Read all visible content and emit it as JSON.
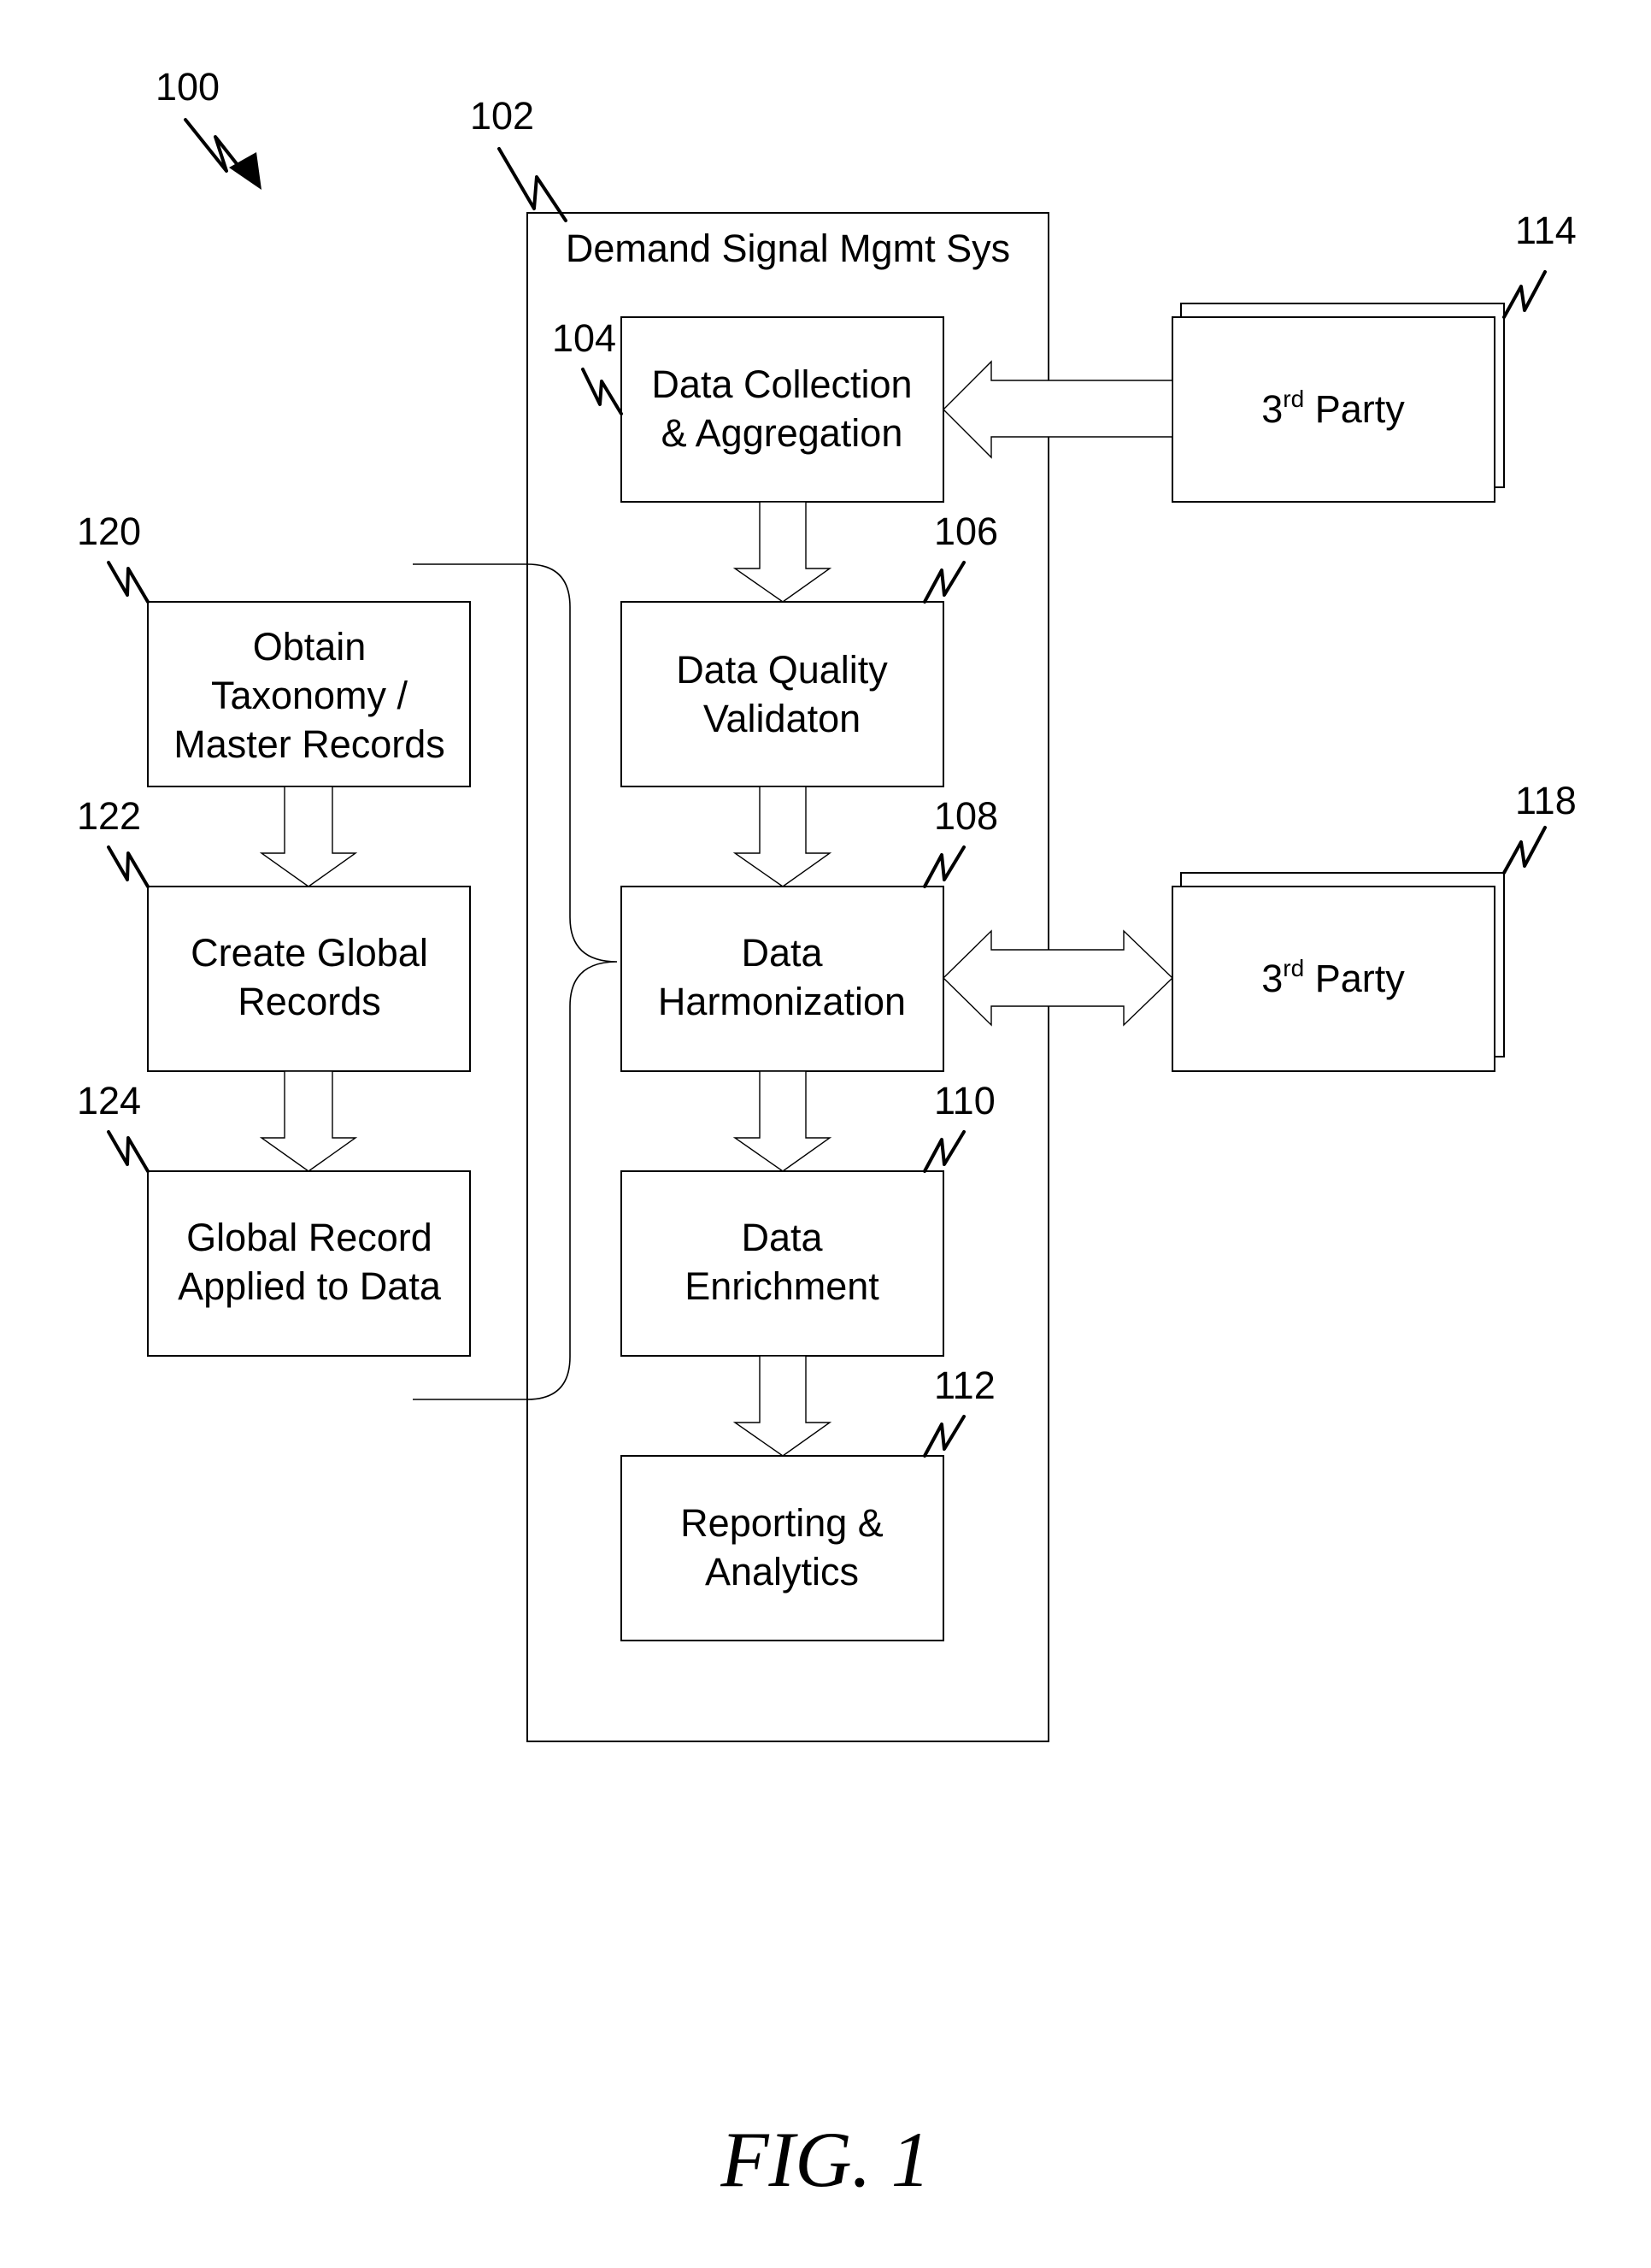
{
  "figure": {
    "caption": "FIG. 1",
    "overall_ref": "100"
  },
  "system": {
    "ref": "102",
    "title": "Demand Signal Mgmt Sys",
    "steps": [
      {
        "ref": "104",
        "lines": [
          "Data Collection",
          "& Aggregation"
        ]
      },
      {
        "ref": "106",
        "lines": [
          "Data Quality",
          "Validaton"
        ]
      },
      {
        "ref": "108",
        "lines": [
          "Data",
          "Harmonization"
        ]
      },
      {
        "ref": "110",
        "lines": [
          "Data",
          "Enrichment"
        ]
      },
      {
        "ref": "112",
        "lines": [
          "Reporting &",
          "Analytics"
        ]
      }
    ]
  },
  "global_records": {
    "steps": [
      {
        "ref": "120",
        "lines": [
          "Obtain",
          "Taxonomy /",
          "Master Records"
        ]
      },
      {
        "ref": "122",
        "lines": [
          "Create Global",
          "Records"
        ]
      },
      {
        "ref": "124",
        "lines": [
          "Global Record",
          "Applied to Data"
        ]
      }
    ]
  },
  "third_parties": [
    {
      "ref": "114",
      "label_main": "3",
      "label_sup": "rd",
      "label_rest": " Party",
      "connection": "one-way into Data Collection & Aggregation"
    },
    {
      "ref": "118",
      "label_main": "3",
      "label_sup": "rd",
      "label_rest": " Party",
      "connection": "two-way with Data Harmonization"
    }
  ]
}
